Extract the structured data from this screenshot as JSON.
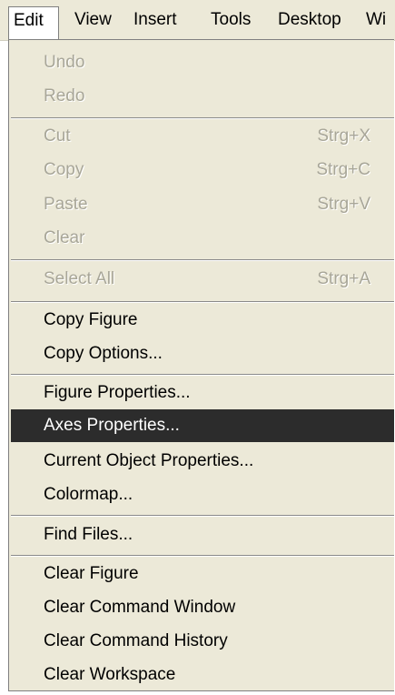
{
  "menubar": {
    "items": [
      {
        "label": "Edit"
      },
      {
        "label": "View"
      },
      {
        "label": "Insert"
      },
      {
        "label": "Tools"
      },
      {
        "label": "Desktop"
      },
      {
        "label": "Wi"
      }
    ]
  },
  "edit_menu": {
    "undo": {
      "label": "Undo"
    },
    "redo": {
      "label": "Redo"
    },
    "cut": {
      "label": "Cut",
      "shortcut": "Strg+X"
    },
    "copy": {
      "label": "Copy",
      "shortcut": "Strg+C"
    },
    "paste": {
      "label": "Paste",
      "shortcut": "Strg+V"
    },
    "clear": {
      "label": "Clear"
    },
    "select_all": {
      "label": "Select All",
      "shortcut": "Strg+A"
    },
    "copy_figure": {
      "label": "Copy Figure"
    },
    "copy_options": {
      "label": "Copy Options..."
    },
    "figure_properties": {
      "label": "Figure Properties..."
    },
    "axes_properties": {
      "label": "Axes Properties..."
    },
    "current_object_properties": {
      "label": "Current Object Properties..."
    },
    "colormap": {
      "label": "Colormap..."
    },
    "find_files": {
      "label": "Find Files..."
    },
    "clear_figure": {
      "label": "Clear Figure"
    },
    "clear_command_window": {
      "label": "Clear Command Window"
    },
    "clear_command_history": {
      "label": "Clear Command History"
    },
    "clear_workspace": {
      "label": "Clear Workspace"
    }
  },
  "colors": {
    "menu_background": "#ece9d8",
    "highlight_background": "#2c2c2c",
    "highlight_text": "#ffffff",
    "disabled_text": "#a8a698"
  }
}
